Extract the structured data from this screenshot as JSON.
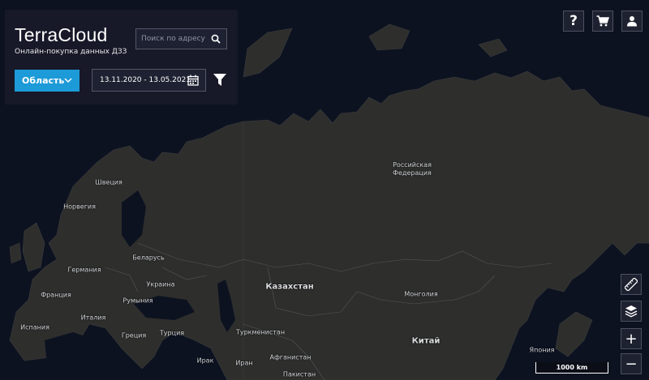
{
  "app": {
    "logo": "TerraCloud",
    "subtitle": "Онлайн-покупка данных ДЗЗ"
  },
  "search": {
    "placeholder": "Поиск по адресу"
  },
  "filters": {
    "region_label": "Область",
    "date_range": "13.11.2020 - 13.05.2021"
  },
  "toolbar": {
    "help_label": "?",
    "zoom_in_label": "+",
    "zoom_out_label": "−"
  },
  "map": {
    "scale_label": "1000 km",
    "labels": {
      "russia": "Российская Федерация",
      "sweden": "Швеция",
      "norway": "Норвегия",
      "belarus": "Беларусь",
      "germany": "Германия",
      "ukraine": "Украина",
      "france": "Франция",
      "romania": "Румыния",
      "spain": "Испания",
      "italy": "Италия",
      "greece": "Греция",
      "turkey": "Турция",
      "kazakhstan": "Казахстан",
      "mongolia": "Монголия",
      "turkmenistan": "Туркменистан",
      "china": "Китай",
      "japan": "Япония",
      "iraq": "Ирак",
      "iran": "Иран",
      "afghanistan": "Афганистан",
      "pakistan": "Пакистан"
    }
  },
  "colors": {
    "ocean": "#0d1220",
    "land": "#2e2e2d",
    "accent": "#1d9ad8",
    "panel": "#181a2a"
  }
}
